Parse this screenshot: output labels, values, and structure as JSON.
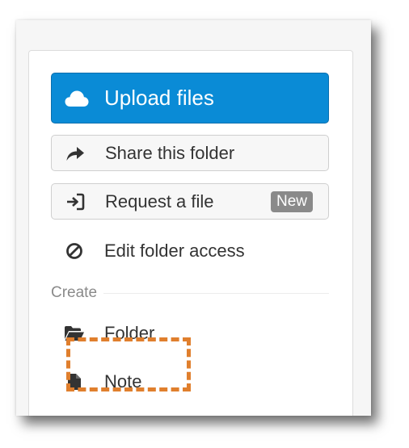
{
  "actions": {
    "upload": {
      "label": "Upload files",
      "icon": "cloud-icon"
    },
    "share": {
      "label": "Share this folder",
      "icon": "share-arrow-icon"
    },
    "request": {
      "label": "Request a file",
      "icon": "sign-in-icon",
      "badge": "New"
    },
    "edit_access": {
      "label": "Edit folder access",
      "icon": "ban-icon"
    }
  },
  "create": {
    "heading": "Create",
    "items": [
      {
        "label": "Folder",
        "icon": "folder-open-icon",
        "highlighted": true
      },
      {
        "label": "Note",
        "icon": "file-icon"
      }
    ]
  },
  "colors": {
    "primary": "#0a8bd6",
    "highlight": "#e07f2d",
    "badge": "#8a8a8a",
    "text": "#333333",
    "muted": "#8a8a8a"
  }
}
